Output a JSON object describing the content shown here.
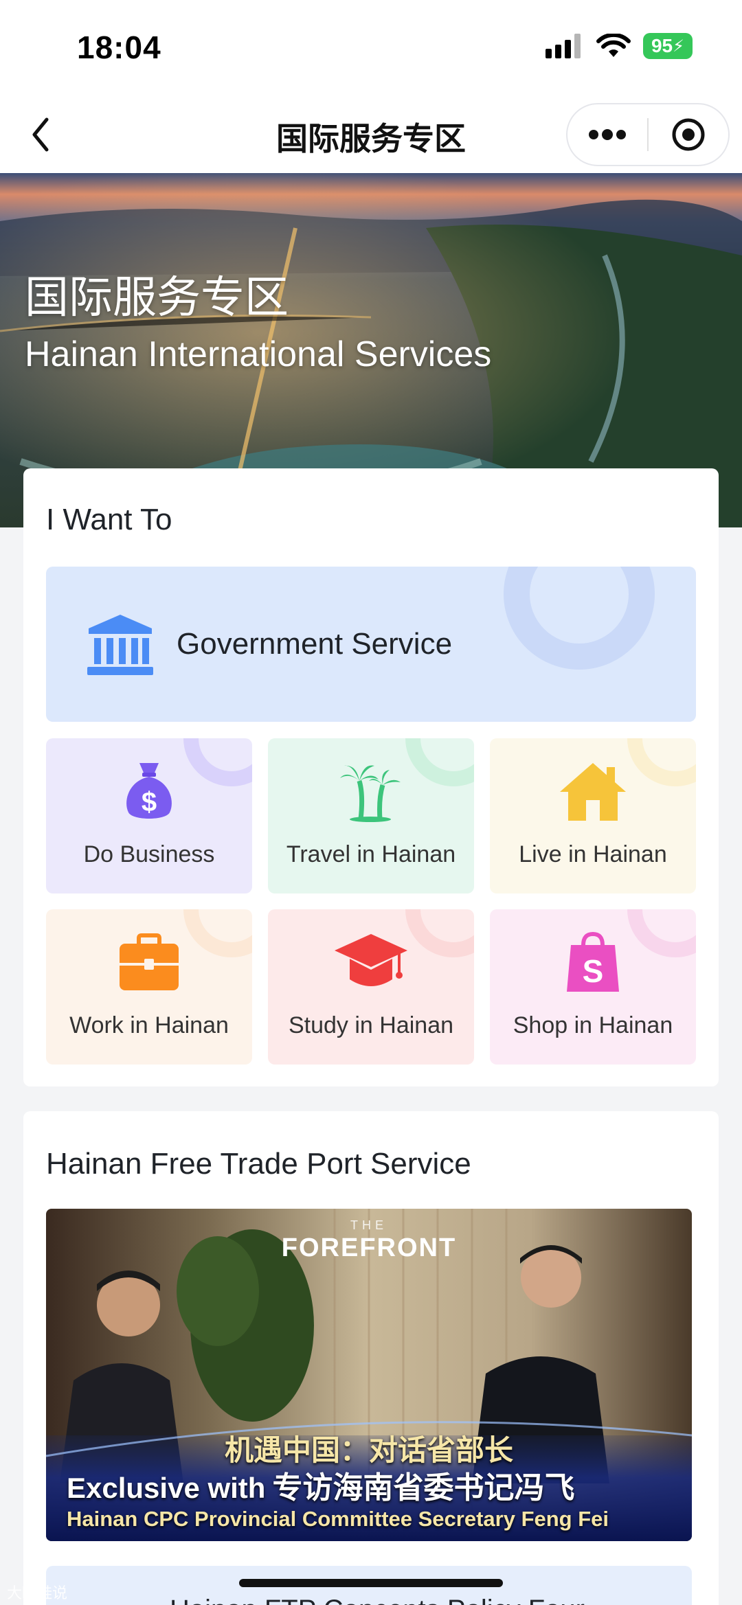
{
  "status_bar": {
    "time": "18:04",
    "battery": "95"
  },
  "nav": {
    "title": "国际服务专区",
    "back_icon": "chevron-left-icon",
    "more_icon": "more-dots-icon",
    "close_icon": "target-circle-icon"
  },
  "hero": {
    "title_cn": "国际服务专区",
    "title_en": "Hainan International Services"
  },
  "want": {
    "title": "I Want To",
    "government": {
      "label": "Government Service",
      "icon": "bank-building-icon",
      "color": "#4b8cf5"
    },
    "tiles": [
      {
        "label": "Do Business",
        "icon": "money-bag-icon",
        "bg": "#ece9fc",
        "color": "#7b5cf0"
      },
      {
        "label": "Travel in Hainan",
        "icon": "palm-tree-icon",
        "bg": "#e6f7ef",
        "color": "#3cc47b"
      },
      {
        "label": "Live in Hainan",
        "icon": "house-icon",
        "bg": "#fcf8ea",
        "color": "#f6c43a"
      },
      {
        "label": "Work in Hainan",
        "icon": "briefcase-icon",
        "bg": "#fdf3ea",
        "color": "#fb8c1e"
      },
      {
        "label": "Study in Hainan",
        "icon": "graduation-cap-icon",
        "bg": "#fdeaea",
        "color": "#ef3e3e"
      },
      {
        "label": "Shop in Hainan",
        "icon": "shopping-bag-icon",
        "bg": "#fcebf6",
        "color": "#ea4fc2"
      }
    ]
  },
  "ftp": {
    "title": "Hainan Free Trade Port Service",
    "video": {
      "brand_top": "THE",
      "brand": "FOREFRONT",
      "headline_cn": "机遇中国：对话省部长",
      "headline_en_prefix": "Exclusive with",
      "headline_cn2": "专访海南省委书记冯飞",
      "subtitle": "Hainan CPC Provincial Committee Secretary Feng Fei"
    },
    "next_item_label": "Hainan FTP Concepts Policy Four..."
  },
  "watermark": "大眼蛙说"
}
